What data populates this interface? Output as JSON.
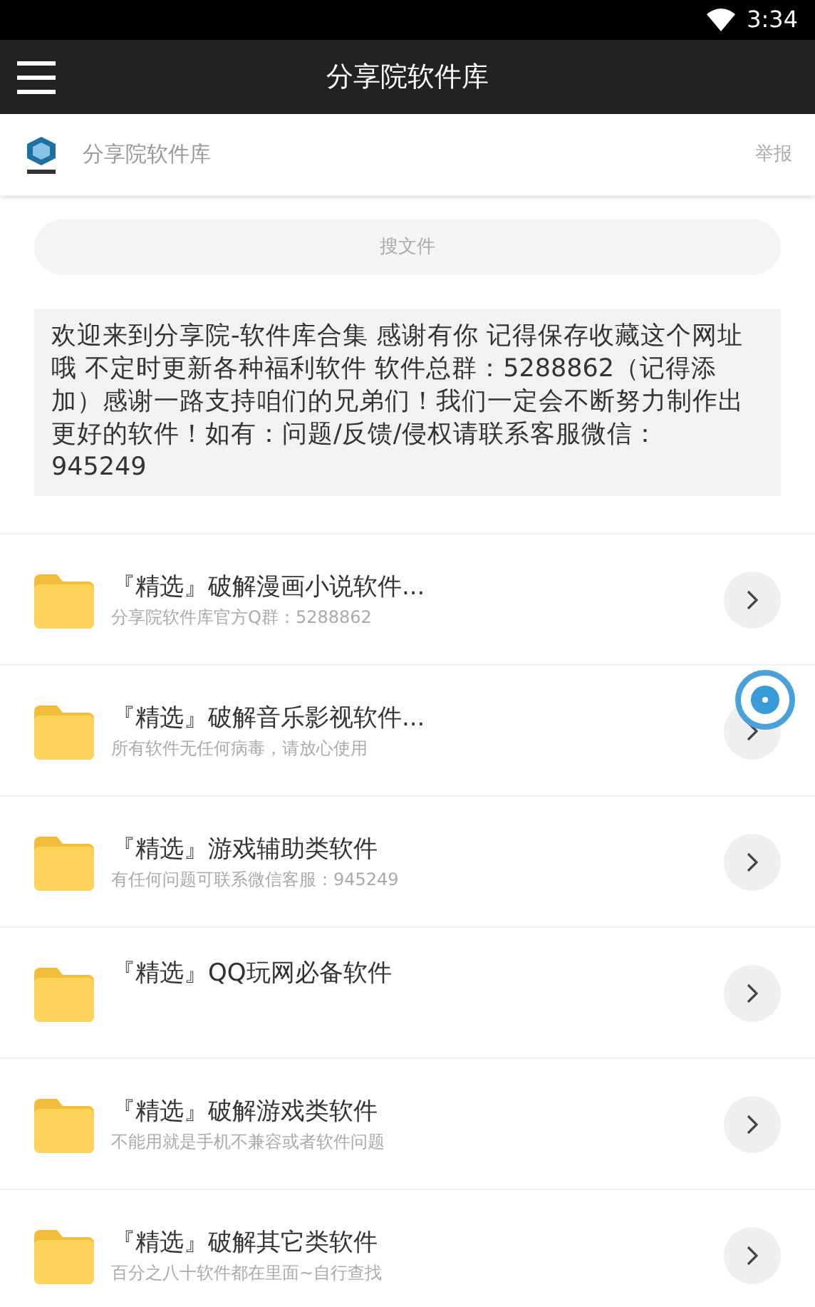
{
  "status_bar": {
    "time": "3:34"
  },
  "toolbar": {
    "title": "分享院软件库"
  },
  "header": {
    "name": "分享院软件库",
    "report": "举报"
  },
  "search": {
    "placeholder": "搜文件"
  },
  "notice": "欢迎来到分享院-软件库合集 感谢有你 记得保存收藏这个网址哦 不定时更新各种福利软件 软件总群：5288862（记得添加）感谢一路支持咱们的兄弟们！我们一定会不断努力制作出更好的软件！如有：问题/反馈/侵权请联系客服微信：945249",
  "folders": [
    {
      "title": "『精选』破解漫画小说软件...",
      "subtitle": "分享院软件库官方Q群：5288862"
    },
    {
      "title": "『精选』破解音乐影视软件...",
      "subtitle": "所有软件无任何病毒，请放心使用"
    },
    {
      "title": "『精选』游戏辅助类软件",
      "subtitle": "有任何问题可联系微信客服：945249"
    },
    {
      "title": "『精选』QQ玩网必备软件"
    },
    {
      "title": "『精选』破解游戏类软件",
      "subtitle": "不能用就是手机不兼容或者软件问题"
    },
    {
      "title": "『精选』破解其它类软件",
      "subtitle": "百分之八十软件都在里面~自行查找"
    }
  ]
}
